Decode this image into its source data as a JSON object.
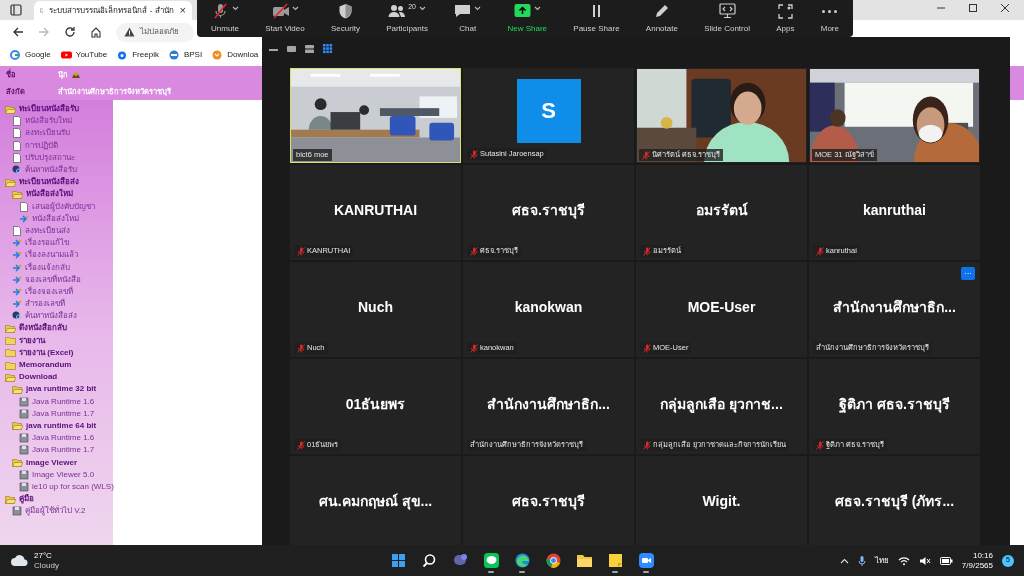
{
  "browser": {
    "tab": {
      "title": "ระบบสารบรรณอิเล็กทรอนิกส์ - สำนัก",
      "close": "×"
    },
    "address": {
      "security": "ไม่ปลอดภัย"
    },
    "bookmarks": [
      {
        "kind": "google",
        "label": "Google"
      },
      {
        "kind": "youtube",
        "label": "YouTube"
      },
      {
        "kind": "freepik",
        "label": "Freepik"
      },
      {
        "kind": "bpsi",
        "label": "BPSI"
      },
      {
        "kind": "download",
        "label": "Downloa"
      }
    ]
  },
  "page_header": {
    "name_label": "ชื่อ",
    "org_label": "สังกัด",
    "name": "นุ๊ก",
    "org": "สำนักงานศึกษาธิการจังหวัดราชบุรี"
  },
  "sidebar": {
    "items": [
      {
        "kind": "folder",
        "label": "ทะเบียนหนังสือรับ",
        "expanded": true,
        "children": [
          {
            "kind": "doc",
            "label": "หนังสือรับใหม่"
          },
          {
            "kind": "doc",
            "label": "ลงทะเบียนรับ"
          },
          {
            "kind": "doc",
            "label": "การปฏิบัติ"
          },
          {
            "kind": "doc",
            "label": "ปรับปรุงสถานะ"
          },
          {
            "kind": "search",
            "label": "ค้นหาหนังสือรับ"
          }
        ]
      },
      {
        "kind": "folder",
        "label": "ทะเบียนหนังสือส่ง",
        "expanded": true,
        "children": [
          {
            "kind": "folder",
            "label": "หนังสือส่งใหม่",
            "expanded": true,
            "children": [
              {
                "kind": "doc",
                "label": "เสนอผู้บังคับบัญชา"
              },
              {
                "kind": "action",
                "label": "หนังสือส่งใหม่"
              }
            ]
          },
          {
            "kind": "doc",
            "label": "ลงทะเบียนส่ง"
          },
          {
            "kind": "action",
            "label": "เรื่องรอแก้ไข"
          },
          {
            "kind": "action",
            "label": "เรื่องลงนามแล้ว"
          },
          {
            "kind": "action",
            "label": "เรื่องแจ้งกลับ"
          },
          {
            "kind": "action",
            "label": "จองเลขที่หนังสือ"
          },
          {
            "kind": "action",
            "label": "เรื่องจองเลขที่"
          },
          {
            "kind": "action",
            "label": "สำรองเลขที่"
          },
          {
            "kind": "search",
            "label": "ค้นหาหนังสือส่ง"
          }
        ]
      },
      {
        "kind": "folder",
        "label": "ดึงหนังสือกลับ",
        "expanded": true
      },
      {
        "kind": "folder",
        "label": "รายงาน",
        "expanded": false
      },
      {
        "kind": "folder",
        "label": "รายงาน (Excel)",
        "expanded": false
      },
      {
        "kind": "folder",
        "label": "Memorandum",
        "expanded": false
      },
      {
        "kind": "folder",
        "label": "Download",
        "expanded": true,
        "children": [
          {
            "kind": "folder",
            "label": "java runtime 32 bit",
            "expanded": true,
            "children": [
              {
                "kind": "disk",
                "label": "Java Runtime 1.6"
              },
              {
                "kind": "disk",
                "label": "Java Runtime 1.7"
              }
            ]
          },
          {
            "kind": "folder",
            "label": "java runtime 64 bit",
            "expanded": true,
            "children": [
              {
                "kind": "disk",
                "label": "Java Runtime 1.6"
              },
              {
                "kind": "disk",
                "label": "Java Runtime 1.7"
              }
            ]
          },
          {
            "kind": "folder",
            "label": "Image Viewer",
            "expanded": true,
            "children": [
              {
                "kind": "disk",
                "label": "Image Viewer 5.0"
              },
              {
                "kind": "disk",
                "label": "ie10 up for scan (WLS)"
              }
            ]
          }
        ]
      },
      {
        "kind": "folder",
        "label": "คู่มือ",
        "expanded": true,
        "children": [
          {
            "kind": "disk",
            "label": "คู่มือผู้ใช้ทั่วไป V.2"
          }
        ]
      }
    ]
  },
  "zoom_toolbar": [
    {
      "kind": "mic",
      "label": "Unmute",
      "off": true,
      "has_menu": true
    },
    {
      "kind": "video",
      "label": "Start Video",
      "off": true,
      "has_menu": true
    },
    {
      "kind": "security",
      "label": "Security",
      "has_menu": false
    },
    {
      "kind": "participants",
      "label": "Participants",
      "count": "20",
      "has_menu": true
    },
    {
      "kind": "chat",
      "label": "Chat",
      "has_menu": true
    },
    {
      "kind": "share",
      "label": "New Share",
      "has_menu": true
    },
    {
      "kind": "pause",
      "label": "Pause Share",
      "has_menu": false
    },
    {
      "kind": "annotate",
      "label": "Annotate",
      "has_menu": false
    },
    {
      "kind": "slides",
      "label": "Slide Control",
      "has_menu": false
    },
    {
      "kind": "apps",
      "label": "Apps",
      "has_menu": false
    },
    {
      "kind": "more",
      "label": "More",
      "has_menu": false
    }
  ],
  "gallery": {
    "views": [
      {
        "kind": "minimize",
        "selected": false
      },
      {
        "kind": "single",
        "selected": false
      },
      {
        "kind": "stacked",
        "selected": false
      },
      {
        "kind": "grid",
        "selected": true
      }
    ],
    "tiles": [
      {
        "kind": "video",
        "label": "bict6 moe",
        "active": true,
        "muted": false
      },
      {
        "kind": "avatar",
        "name": "S",
        "label": "Sutasini Jaroensap",
        "active": false,
        "muted": true
      },
      {
        "kind": "video",
        "label": "นิศารัตน์ ศธจ.ราชบุรี",
        "active": false,
        "muted": true
      },
      {
        "kind": "video",
        "label": "MOE 31 ณัฐวิสาข์",
        "active": false,
        "muted": false
      },
      {
        "kind": "name",
        "name": "KANRUTHAI",
        "label": "KANRUTHAI",
        "active": false,
        "muted": true
      },
      {
        "kind": "name",
        "name": "ศธจ.ราชบุรี",
        "label": "ศธจ.ราชบุรี",
        "active": false,
        "muted": true
      },
      {
        "kind": "name",
        "name": "อมรรัตน์",
        "label": "อมรรัตน์",
        "active": false,
        "muted": true
      },
      {
        "kind": "name",
        "name": "kanruthai",
        "label": "kanruthai",
        "active": false,
        "muted": true
      },
      {
        "kind": "name",
        "name": "Nuch",
        "label": "Nuch",
        "active": false,
        "muted": true
      },
      {
        "kind": "name",
        "name": "kanokwan",
        "label": "kanokwan",
        "active": false,
        "muted": true
      },
      {
        "kind": "name",
        "name": "MOE-User",
        "label": "MOE-User",
        "active": false,
        "muted": true
      },
      {
        "kind": "name",
        "name": "สำนักงานศึกษาธิก...",
        "label": "สำนักงานศึกษาธิการจังหวัดราชบุรี",
        "active": false,
        "muted": false,
        "menu_button": "···"
      },
      {
        "kind": "name",
        "name": "01ธันยพร",
        "label": "01ธันยพร",
        "active": false,
        "muted": true
      },
      {
        "kind": "name",
        "name": "สำนักงานศึกษาธิก...",
        "label": "สำนักงานศึกษาธิการจังหวัดราชบุรี",
        "active": false,
        "muted": false
      },
      {
        "kind": "name",
        "name": "กลุ่มลูกเสือ ยุวกาช...",
        "label": "กลุ่มลูกเสือ ยุวกาชาดและกิจการนักเรียน",
        "active": false,
        "muted": true
      },
      {
        "kind": "name",
        "name": "ฐิติภา ศธจ.ราชบุรี",
        "label": "ฐิติภา ศธจ.ราชบุรี",
        "active": false,
        "muted": true
      },
      {
        "kind": "name",
        "name": "ศน.คมกฤษณ์ สุข...",
        "active": false
      },
      {
        "kind": "name",
        "name": "ศธจ.ราชบุรี",
        "active": false
      },
      {
        "kind": "name",
        "name": "Wigit.",
        "active": false
      },
      {
        "kind": "name",
        "name": "ศธจ.ราชบุรี (ภัทร...",
        "active": false
      }
    ]
  },
  "taskbar": {
    "weather": {
      "temperature": "27°C",
      "condition": "Cloudy"
    },
    "apps": [
      {
        "kind": "start",
        "running": false
      },
      {
        "kind": "search",
        "running": false
      },
      {
        "kind": "chat",
        "running": false
      },
      {
        "kind": "line",
        "running": true
      },
      {
        "kind": "edge",
        "running": true
      },
      {
        "kind": "chrome",
        "running": false
      },
      {
        "kind": "explorer",
        "running": false
      },
      {
        "kind": "notes",
        "running": true
      },
      {
        "kind": "zoom",
        "running": true
      }
    ],
    "language": "ไทย",
    "time": "10:16",
    "date": "7/9/2565",
    "notifications": "5"
  }
}
